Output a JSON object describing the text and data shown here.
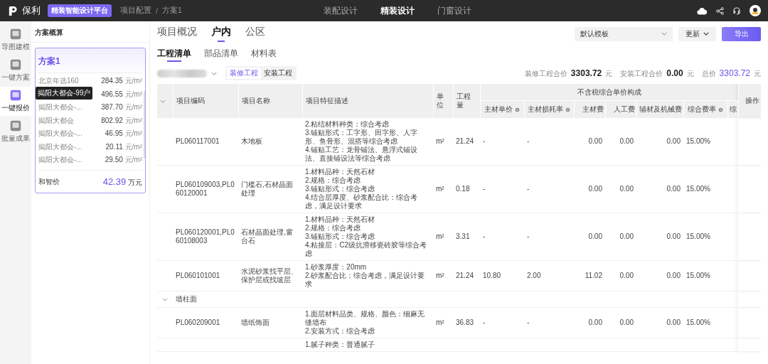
{
  "topbar": {
    "logo": "保利",
    "platform_badge": "精装智能设计平台",
    "breadcrumb": [
      "项目配置",
      "方案1"
    ],
    "breadcrumb_separator": "/",
    "nav": [
      {
        "label": "装配设计",
        "selected": false
      },
      {
        "label": "精装设计",
        "selected": true
      },
      {
        "label": "门窗设计",
        "selected": false
      }
    ]
  },
  "rail": [
    {
      "label": "导图建模",
      "selected": false
    },
    {
      "label": "一键方案",
      "selected": false
    },
    {
      "label": "一键报价",
      "selected": true
    },
    {
      "label": "批量成果",
      "selected": false
    }
  ],
  "estimate": {
    "title": "方案概算",
    "card_title": "方案1",
    "rows": [
      {
        "name": "北京年选160",
        "value": "284.35",
        "unit": "元/m²"
      },
      {
        "value": "496.55",
        "unit": "元/m²"
      },
      {
        "name": "揭阳大都会-...",
        "value": "387.70",
        "unit": "元/m²"
      },
      {
        "name": "揭阳大都会",
        "value": "802.92",
        "unit": "元/m²"
      },
      {
        "name": "揭阳大都会-...",
        "value": "46.95",
        "unit": "元/m²"
      },
      {
        "name": "揭阳大都会-...",
        "value": "20.11",
        "unit": "元/m²"
      },
      {
        "name": "揭阳大都会-...",
        "value": "29.50",
        "unit": "元/m²"
      }
    ],
    "tooltip": "揭阳大都会-99户",
    "footer_label": "和智价",
    "footer_value": "42.39",
    "footer_unit": "万元"
  },
  "tabs": [
    {
      "label": "项目概况",
      "selected": false
    },
    {
      "label": "户内",
      "selected": true
    },
    {
      "label": "公区",
      "selected": false
    }
  ],
  "template_select": "默认模板",
  "update_button": "更新",
  "export_button": "导出",
  "subtabs": [
    {
      "label": "工程清单",
      "selected": true
    },
    {
      "label": "部品清单",
      "selected": false
    },
    {
      "label": "材料表",
      "selected": false
    }
  ],
  "segments": [
    {
      "label": "装修工程",
      "selected": true
    },
    {
      "label": "安装工程",
      "selected": false
    }
  ],
  "totals": [
    {
      "label": "装修工程合价",
      "value": "3303.72",
      "unit": "元",
      "kind": "plain"
    },
    {
      "label": "安装工程合价",
      "value": "0.00",
      "unit": "元",
      "kind": "plain"
    },
    {
      "label": "总价",
      "value": "3303.72",
      "unit": "元",
      "kind": "highlight"
    }
  ],
  "table": {
    "columns": [
      "项目编码",
      "项目名称",
      "项目特征描述",
      "单位",
      "工程量"
    ],
    "group_heading": "不含税综合单价构成",
    "subcolumns": [
      {
        "label": "主材单价",
        "setting": true
      },
      {
        "label": "主材损耗率",
        "setting": true
      },
      {
        "label": "主材费",
        "setting": false
      },
      {
        "label": "人工费",
        "setting": false
      },
      {
        "label": "辅材及机械费",
        "setting": false
      },
      {
        "label": "综合费率",
        "setting": true
      },
      {
        "label": "综"
      }
    ],
    "action_heading": "操作",
    "rows": [
      {
        "kind": "item",
        "code": "PL060117001",
        "name": "木地板",
        "desc": [
          "2.粘结材料种类：综合考虑",
          "3.铺贴形式：工字形、田字形、人字形、鱼骨形、混搭等综合考虑",
          "4.铺贴工艺：龙骨铺法、悬浮式铺设法、直接铺设法等综合考虑"
        ],
        "unit": "m²",
        "qty": "21.24",
        "cells": [
          "-",
          "-",
          "0.00",
          "0.00",
          "0.00",
          "15.00%"
        ]
      },
      {
        "kind": "item",
        "code": "PL060109003,PL060120001",
        "name": "门槛石,石材晶面处理",
        "desc": [
          "1.材料品种：天然石材",
          "2.规格：综合考虑",
          "3.铺贴形式：综合考虑",
          "4.结合层厚度、砂浆配合比：综合考虑，满足设计要求"
        ],
        "unit": "m²",
        "qty": "0.18",
        "cells": [
          "-",
          "-",
          "0.00",
          "0.00",
          "0.00",
          "15.00%"
        ]
      },
      {
        "kind": "item",
        "code": "PL060120001,PL060108003",
        "name": "石材晶面处理,窗台石",
        "desc": [
          "1.材料品种：天然石材",
          "2.规格：综合考虑",
          "3.铺贴形式：综合考虑",
          "4.粘接层：C2级抗滑移瓷砖胶等综合考虑"
        ],
        "unit": "m²",
        "qty": "3.31",
        "cells": [
          "-",
          "-",
          "0.00",
          "0.00",
          "0.00",
          "15.00%"
        ]
      },
      {
        "kind": "item",
        "code": "PL060101001",
        "name": "水泥砂浆找平层、保护层或找坡层",
        "desc": [
          "1.砂浆厚度：20mm",
          "2.砂浆配合比：综合考虑，满足设计要求"
        ],
        "unit": "m²",
        "qty": "21.24",
        "cells": [
          "10.80",
          "2.00",
          "11.02",
          "0.00",
          "0.00",
          "15.00%"
        ]
      },
      {
        "kind": "group",
        "name": "墙柱面",
        "expanded": true
      },
      {
        "kind": "item",
        "code": "PL060209001",
        "name": "墙纸饰面",
        "desc": [
          "1.面层材料品类、规格、颜色：细麻无缝墙布",
          "2.安装方式：综合考虑"
        ],
        "unit": "m²",
        "qty": "36.83",
        "cells": [
          "-",
          "-",
          "0.00",
          "0.00",
          "0.00",
          "15.00%"
        ]
      },
      {
        "kind": "item",
        "desc": [
          "1.腻子种类：普通腻子"
        ]
      }
    ]
  }
}
